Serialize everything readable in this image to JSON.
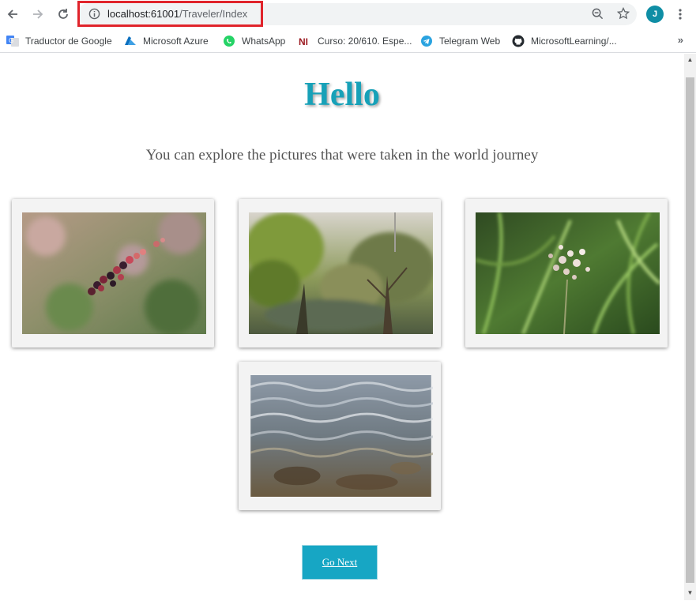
{
  "browser": {
    "url_host": "localhost:61001",
    "url_path": "/Traveler/Index",
    "avatar_letter": "J",
    "bookmarks": [
      {
        "label": "Traductor de Google",
        "icon": "google-translate-icon"
      },
      {
        "label": "Microsoft Azure",
        "icon": "azure-icon"
      },
      {
        "label": "WhatsApp",
        "icon": "whatsapp-icon"
      },
      {
        "label": "Curso: 20/610. Espe...",
        "icon": "ni-icon"
      },
      {
        "label": "Telegram Web",
        "icon": "telegram-icon"
      },
      {
        "label": "MicrosoftLearning/...",
        "icon": "github-icon"
      }
    ],
    "more_bookmarks": "»"
  },
  "page": {
    "heading": "Hello",
    "subtitle": "You can explore the pictures that were taken in the world journey",
    "photos": [
      {
        "subject": "berries"
      },
      {
        "subject": "trees"
      },
      {
        "subject": "plants"
      },
      {
        "subject": "water"
      }
    ],
    "next_button": "Go Next"
  },
  "colors": {
    "accent": "#17a1b8",
    "button": "#17a6c4",
    "highlight_border": "#e0242b"
  }
}
